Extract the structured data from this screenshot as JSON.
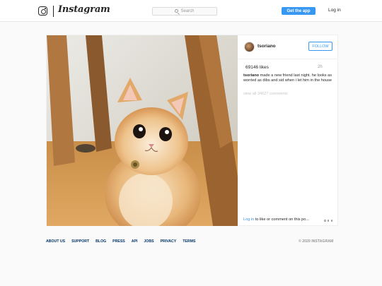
{
  "header": {
    "logo_text": "Instagram",
    "search_placeholder": "Search",
    "get_app_label": "Get the app",
    "login_label": "Log in"
  },
  "post": {
    "username": "tsoriano",
    "follow_label": "FOLLOW",
    "likes": "69146 likes",
    "time_ago": "2h",
    "caption_user": "tsoriano",
    "caption_text": "made a new friend last night. he looks as worried as dibs and sid when i let him in the house",
    "view_all_comments": "view all 34627 comments",
    "login_link": "Log in",
    "login_prompt_rest": "to like or comment on this po...",
    "image_subject": "ginger-cat-photo"
  },
  "footer": {
    "links": [
      "ABOUT US",
      "SUPPORT",
      "BLOG",
      "PRESS",
      "API",
      "JOBS",
      "PRIVACY",
      "TERMS"
    ],
    "copyright": "© 2020 INSTAGRAM"
  },
  "colors": {
    "accent": "#3897f0",
    "footer_link": "#003569",
    "muted": "#999999"
  }
}
